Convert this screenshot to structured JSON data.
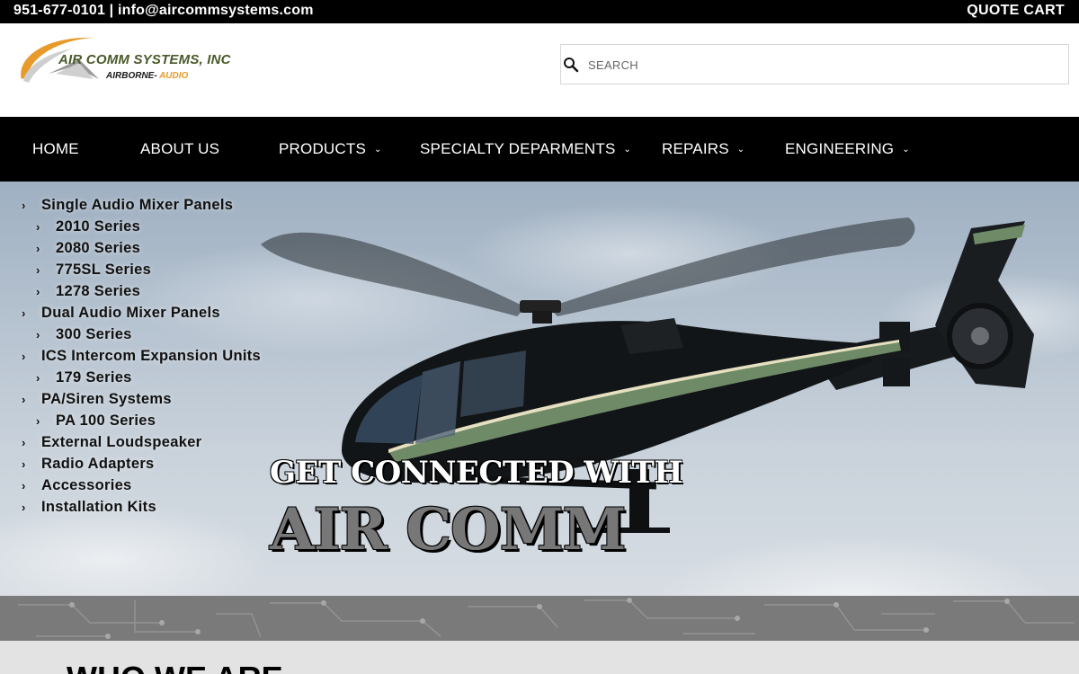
{
  "topbar": {
    "contact": "951-677-0101 | info@aircommsystems.com",
    "quote_cart": "QUOTE CART"
  },
  "header": {
    "logo_name": "AIR COMM SYSTEMS, INC",
    "logo_sub_1": "AIRBORNE- ",
    "logo_sub_2": "AUDIO",
    "search_placeholder": "SEARCH",
    "search_icon": "search-icon"
  },
  "nav": {
    "items": [
      {
        "label": "HOME",
        "dropdown": false
      },
      {
        "label": "ABOUT US",
        "dropdown": false
      },
      {
        "label": "PRODUCTS",
        "dropdown": true
      },
      {
        "label": "SPECIALTY DEPARMENTS",
        "dropdown": true
      },
      {
        "label": "REPAIRS",
        "dropdown": true
      },
      {
        "label": "ENGINEERING",
        "dropdown": true
      }
    ],
    "chevron": "⌄"
  },
  "sidemenu": [
    {
      "label": "Single Audio Mixer Panels",
      "level": 0
    },
    {
      "label": "2010 Series",
      "level": 1
    },
    {
      "label": "2080 Series",
      "level": 1
    },
    {
      "label": "775SL Series",
      "level": 1
    },
    {
      "label": "1278 Series",
      "level": 1
    },
    {
      "label": "Dual Audio Mixer Panels",
      "level": 0
    },
    {
      "label": "300 Series",
      "level": 1
    },
    {
      "label": "ICS Intercom Expansion Units",
      "level": 0
    },
    {
      "label": "179 Series",
      "level": 1
    },
    {
      "label": "PA/Siren Systems",
      "level": 0
    },
    {
      "label": "PA 100 Series",
      "level": 1
    },
    {
      "label": "External Loudspeaker",
      "level": 0
    },
    {
      "label": "Radio Adapters",
      "level": 0
    },
    {
      "label": "Accessories",
      "level": 0
    },
    {
      "label": "Installation Kits",
      "level": 0
    }
  ],
  "hero": {
    "tagline_1": "GET CONNECTED WITH",
    "tagline_2": "AIR COMM"
  },
  "section": {
    "heading": "WHO WE ARE"
  },
  "colors": {
    "bar": "#000000",
    "logo_green": "#4a5a2a",
    "logo_orange": "#e89a2a",
    "heli_stripe": "#6f8a66"
  }
}
